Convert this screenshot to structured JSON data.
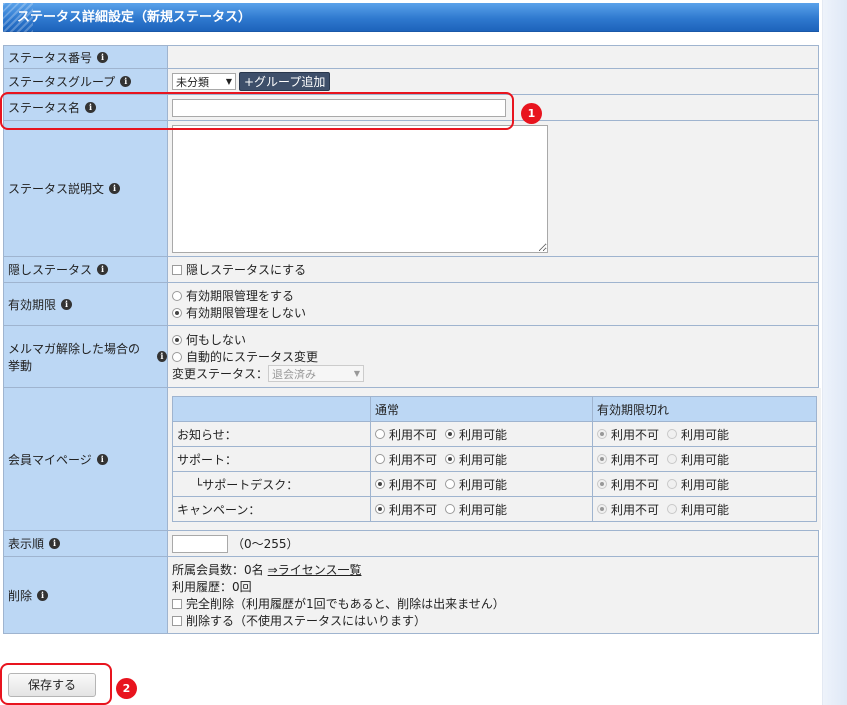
{
  "title": "ステータス詳細設定（新規ステータス）",
  "rows": {
    "status_number": {
      "label": "ステータス番号"
    },
    "status_group": {
      "label": "ステータスグループ",
      "select_value": "未分類",
      "add_button": "+グループ追加"
    },
    "status_name": {
      "label": "ステータス名",
      "value": ""
    },
    "status_description": {
      "label": "ステータス説明文",
      "value": ""
    },
    "hidden_status": {
      "label": "隠しステータス",
      "checkbox_label": "隠しステータスにする"
    },
    "expiration": {
      "label": "有効期限",
      "option_manage": "有効期限管理をする",
      "option_no_manage": "有効期限管理をしない"
    },
    "unsubscribe_behavior": {
      "label": "メルマガ解除した場合の挙動",
      "option_nothing": "何もしない",
      "option_auto_change": "自動的にステータス変更",
      "change_status_label": "変更ステータス：",
      "change_status_value": "退会済み"
    },
    "mypage": {
      "label": "会員マイページ",
      "col_normal": "通常",
      "col_expired": "有効期限切れ",
      "unavailable": "利用不可",
      "available": "利用可能",
      "items": [
        {
          "name": "お知らせ：",
          "normal": "available",
          "expired": "unavailable"
        },
        {
          "name": "サポート：",
          "normal": "available",
          "expired": "unavailable"
        },
        {
          "name": "└サポートデスク：",
          "normal": "unavailable",
          "expired": "unavailable"
        },
        {
          "name": "キャンペーン：",
          "normal": "unavailable",
          "expired": "unavailable"
        }
      ]
    },
    "display_order": {
      "label": "表示順",
      "value": "",
      "range": "（0～255）"
    },
    "delete": {
      "label": "削除",
      "members_text": "所属会員数：0名",
      "license_link": "⇒ライセンス一覧",
      "usage_text": "利用履歴：0回",
      "full_delete": "完全削除（利用履歴が1回でもあると、削除は出来ません）",
      "soft_delete": "削除する（不使用ステータスにはいります）"
    }
  },
  "save_button": "保存する",
  "callouts": {
    "one": "1",
    "two": "2"
  },
  "colors": {
    "header": "#2f79cf",
    "label_bg": "#bcd7f4",
    "callout": "#e8141e"
  }
}
